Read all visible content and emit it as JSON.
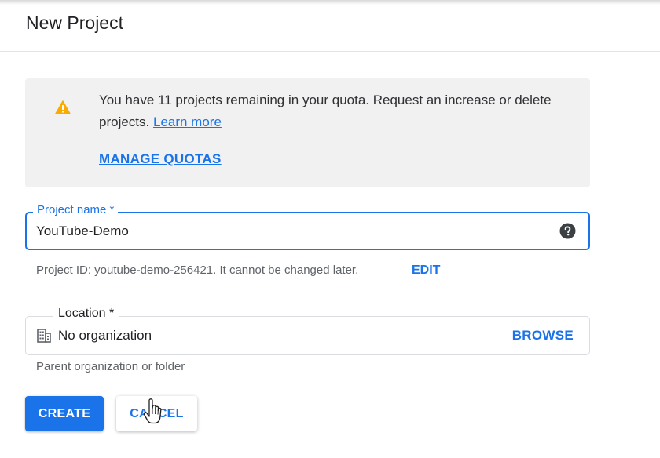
{
  "header": {
    "title": "New Project"
  },
  "quota_notice": {
    "icon": "warning-icon",
    "icon_color": "#f9ab00",
    "message": "You have 11 projects remaining in your quota. Request an increase or delete projects.",
    "learn_more_label": "Learn more",
    "manage_quotas_label": "MANAGE QUOTAS"
  },
  "project_name": {
    "label": "Project name *",
    "value": "YouTube-Demo",
    "help_icon": "help-icon"
  },
  "project_id": {
    "text": "Project ID: youtube-demo-256421. It cannot be changed later.",
    "edit_label": "EDIT"
  },
  "location": {
    "label": "Location *",
    "icon": "building-icon",
    "value": "No organization",
    "browse_label": "BROWSE",
    "hint": "Parent organization or folder"
  },
  "actions": {
    "create_label": "CREATE",
    "cancel_label": "CANCEL"
  },
  "colors": {
    "accent": "#1a73e8",
    "notice_background": "#f1f1f1"
  }
}
